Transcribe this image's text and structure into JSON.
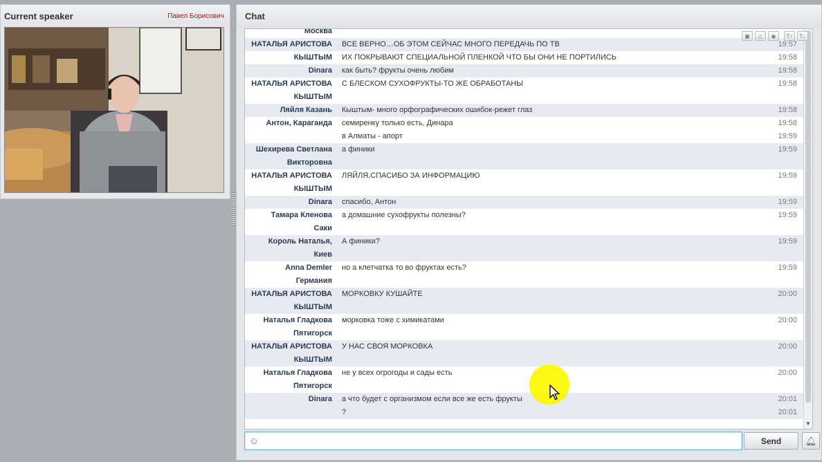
{
  "speaker": {
    "title": "Current speaker",
    "name": "Павел Борисович"
  },
  "chat": {
    "title": "Chat",
    "tool_icons": [
      "image-icon",
      "warning-icon",
      "info-icon",
      "font-increase-icon",
      "font-decrease-icon"
    ],
    "tool_glyphs": [
      "▣",
      "△",
      "◉",
      "T↑",
      "T↓"
    ],
    "rows": [
      {
        "sender": "Москва",
        "text": "",
        "time": ""
      },
      {
        "sender": "НАТАЛЬЯ АРИСТОВА",
        "text": "ВСЕ ВЕРНО…ОБ ЭТОМ СЕЙЧАС МНОГО ПЕРЕДАЧЬ ПО ТВ",
        "time": "19:57"
      },
      {
        "sender": "КЫШТЫМ",
        "text": "ИХ ПОКРЫВАЮТ СПЕЦИАЛЬНОЙ ПЛЕНКОЙ ЧТО БЫ ОНИ НЕ ПОРТИЛИСЬ",
        "time": "19:58"
      },
      {
        "sender": "Dinara",
        "text": "как быть? фрукты очень любим",
        "time": "19:58"
      },
      {
        "sender": "НАТАЛЬЯ АРИСТОВА",
        "text": "С БЛЕСКОМ СУХОФРУКТЫ-ТО ЖЕ ОБРАБОТАНЫ",
        "time": "19:58"
      },
      {
        "sender": "КЫШТЫМ",
        "text": "",
        "time": ""
      },
      {
        "sender": "Ляйля Казань",
        "text": "Кыштым- много орфографических ошибок-режет глаз",
        "time": "19:58"
      },
      {
        "sender": "Антон, Караганда",
        "text": "семиренку только есть, Динара",
        "time": "19:58"
      },
      {
        "sender": "",
        "text": "в Алматы - апорт",
        "time": "19:59"
      },
      {
        "sender": "Шехирева Светлана",
        "text": "а финики",
        "time": "19:59"
      },
      {
        "sender": "Викторовна",
        "text": "",
        "time": ""
      },
      {
        "sender": "НАТАЛЬЯ АРИСТОВА",
        "text": "ЛЯЙЛЯ,СПАСИБО ЗА ИНФОРМАЦИЮ",
        "time": "19:59"
      },
      {
        "sender": "КЫШТЫМ",
        "text": "",
        "time": ""
      },
      {
        "sender": "Dinara",
        "text": "спасибо, Антон",
        "time": "19:59"
      },
      {
        "sender": "Тамара Кленова",
        "text": "а домашние сухофрукты полезны?",
        "time": "19:59"
      },
      {
        "sender": "Саки",
        "text": "",
        "time": ""
      },
      {
        "sender": "Король Наталья,",
        "text": "А финики?",
        "time": "19:59"
      },
      {
        "sender": "Киев",
        "text": "",
        "time": ""
      },
      {
        "sender": "Anna Demler",
        "text": "но а клетчатка то во фруктах есть?",
        "time": "19:59"
      },
      {
        "sender": "Германия",
        "text": "",
        "time": ""
      },
      {
        "sender": "НАТАЛЬЯ АРИСТОВА",
        "text": "МОРКОВКУ КУШАЙТЕ",
        "time": "20:00"
      },
      {
        "sender": "КЫШТЫМ",
        "text": "",
        "time": ""
      },
      {
        "sender": "Наталья Гладкова",
        "text": "морковка тоже с химикатами",
        "time": "20:00"
      },
      {
        "sender": "Пятигорск",
        "text": "",
        "time": ""
      },
      {
        "sender": "НАТАЛЬЯ АРИСТОВА",
        "text": "У НАС СВОЯ МОРКОВКА",
        "time": "20:00"
      },
      {
        "sender": "КЫШТЫМ",
        "text": "",
        "time": ""
      },
      {
        "sender": "Наталья Гладкова",
        "text": "не у всех огрогоды и сады есть",
        "time": "20:00"
      },
      {
        "sender": "Пятигорск",
        "text": "",
        "time": ""
      },
      {
        "sender": "Dinara",
        "text": "а что будет с организмом если все же есть фрукты",
        "time": "20:01"
      },
      {
        "sender": "",
        "text": "?",
        "time": "20:01"
      }
    ],
    "row_shading": [
      0,
      1,
      0,
      1,
      0,
      0,
      1,
      0,
      0,
      1,
      1,
      0,
      0,
      1,
      0,
      0,
      1,
      1,
      0,
      0,
      1,
      1,
      0,
      0,
      1,
      1,
      0,
      0,
      1,
      1
    ]
  },
  "composer": {
    "placeholder": "",
    "send_label": "Send"
  },
  "colors": {
    "speaker_name": "#b0151a",
    "sender": "#2a3a52",
    "alt_row": "#e7ebf1",
    "highlight": "#fff600"
  }
}
